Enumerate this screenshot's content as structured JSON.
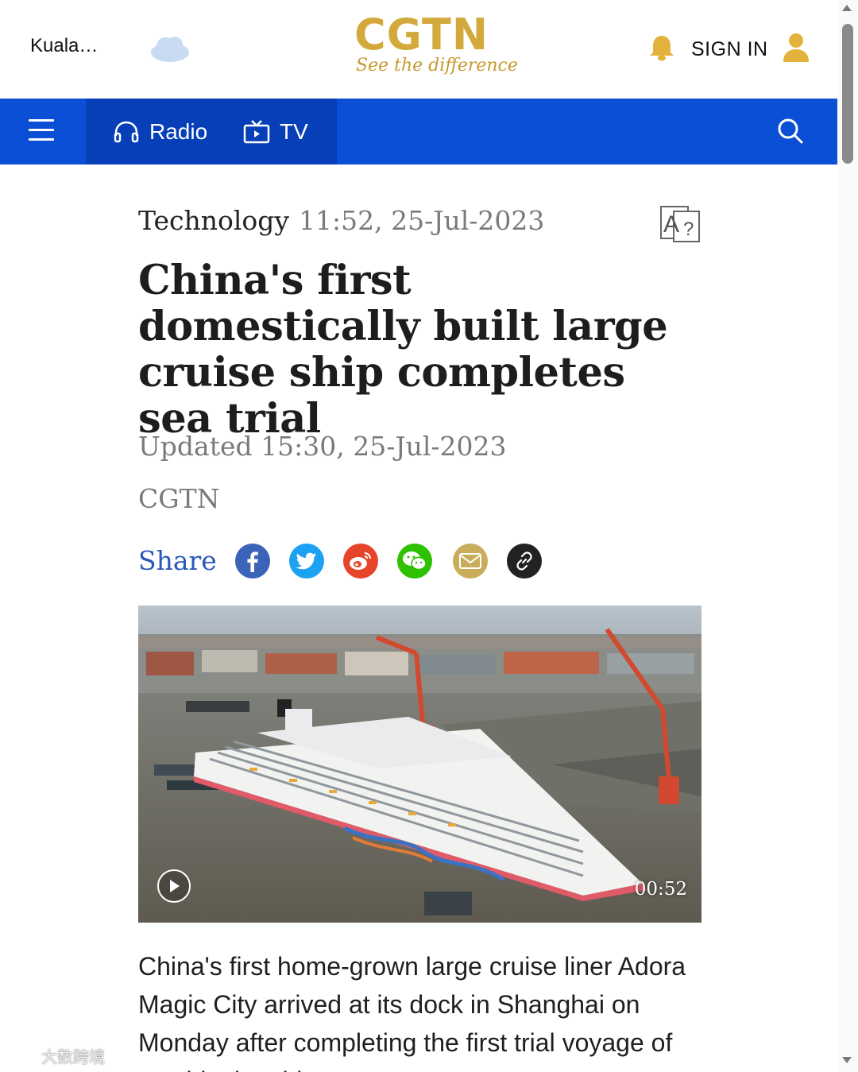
{
  "header": {
    "location": "Kuala…",
    "weather_icon": "cloud-icon",
    "logo_text": "CGTN",
    "logo_tagline": "See the difference",
    "notification_icon": "bell-icon",
    "sign_in_label": "SIGN IN",
    "user_icon": "user-icon",
    "brand_color": "#d4a93c"
  },
  "nav": {
    "menu_icon": "hamburger-icon",
    "items": [
      {
        "label": "Radio",
        "icon": "headphones-icon"
      },
      {
        "label": "TV",
        "icon": "tv-icon"
      }
    ],
    "search_icon": "search-icon",
    "bar_color": "#0b4fd6"
  },
  "article": {
    "category": "Technology",
    "published": "11:52, 25-Jul-2023",
    "translate_icon": "translate-icon",
    "headline": "China's first domestically built large cruise ship completes sea trial",
    "updated": "Updated 15:30, 25-Jul-2023",
    "source": "CGTN",
    "share_label": "Share",
    "share_targets": [
      {
        "name": "facebook",
        "color": "#3b63b8"
      },
      {
        "name": "twitter",
        "color": "#1da1f2"
      },
      {
        "name": "weibo",
        "color": "#e6452b"
      },
      {
        "name": "wechat",
        "color": "#2dc100"
      },
      {
        "name": "email",
        "color": "#c9ad5a"
      },
      {
        "name": "link",
        "color": "#222222"
      }
    ],
    "video": {
      "duration": "00:52",
      "play_icon": "play-icon"
    },
    "body": "China's first home-grown large cruise liner Adora Magic City arrived at its dock in Shanghai on Monday after completing the first trial voyage of outside the ship..."
  },
  "watermark": "大数跨境"
}
